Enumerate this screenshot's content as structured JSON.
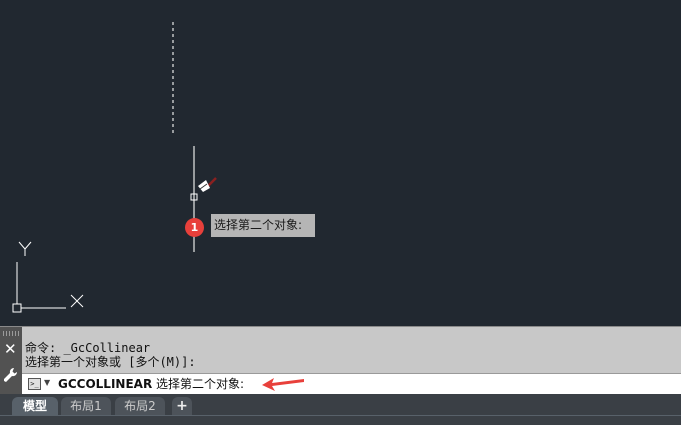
{
  "drawing": {
    "tooltip_text": "选择第二个对象:",
    "step_marker": "1",
    "ucs_x_label": "X",
    "ucs_y_label": "Y"
  },
  "command_panel": {
    "history": [
      "命令: _GcCollinear",
      "选择第一个对象或 [多个(M)]:"
    ],
    "input_command": "GCCOLLINEAR",
    "input_prompt": " 选择第二个对象:",
    "close_icon": "close-icon",
    "settings_icon": "wrench-icon",
    "prompt_icon": "command-prompt-icon"
  },
  "tabs": [
    {
      "label": "模型",
      "active": true
    },
    {
      "label": "布局1",
      "active": false
    },
    {
      "label": "布局2",
      "active": false
    }
  ],
  "add_tab_label": "+",
  "colors": {
    "canvas_bg": "#212830",
    "marker_red": "#e8403b",
    "arrow_red": "#e8403b"
  }
}
